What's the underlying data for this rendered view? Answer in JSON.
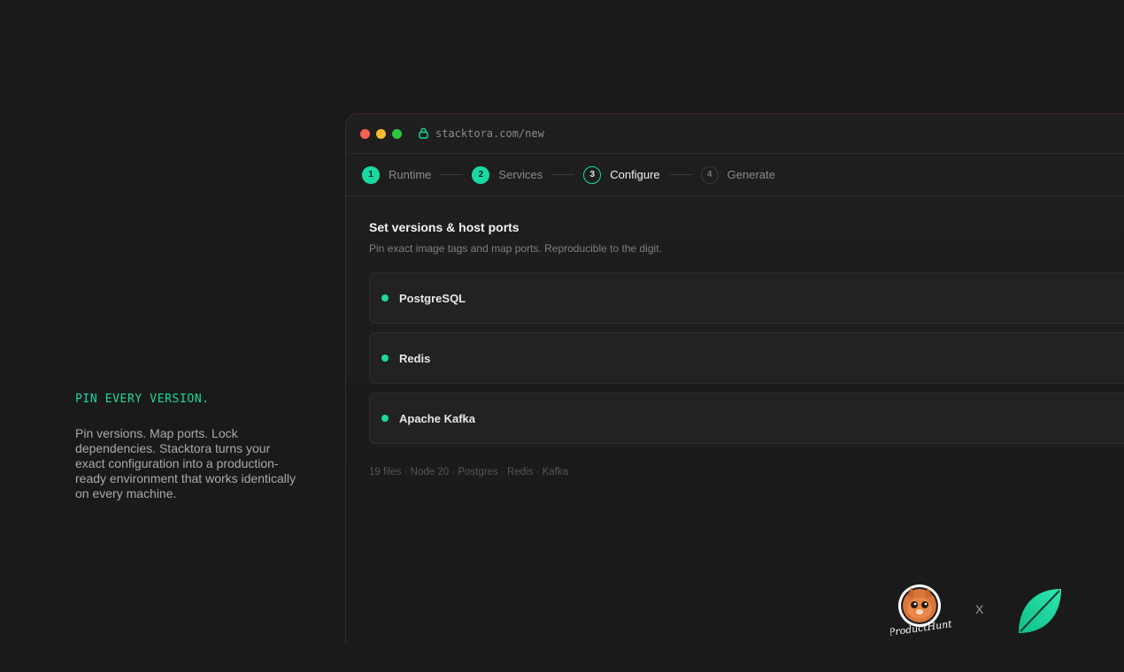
{
  "left": {
    "eyebrow": "PIN EVERY VERSION.",
    "description": "Pin versions. Map ports. Lock dependencies. Stacktora turns your exact configuration into a production-ready environment that works identically on every machine."
  },
  "window": {
    "url": "stacktora.com/new",
    "steps": [
      {
        "number": "1",
        "label": "Runtime",
        "state": "done"
      },
      {
        "number": "2",
        "label": "Services",
        "state": "done"
      },
      {
        "number": "3",
        "label": "Configure",
        "state": "active"
      },
      {
        "number": "4",
        "label": "Generate",
        "state": "todo"
      }
    ],
    "section_title": "Set versions & host ports",
    "section_subtitle": "Pin exact image tags and map ports. Reproducible to the digit.",
    "services": [
      {
        "name": "PostgreSQL"
      },
      {
        "name": "Redis"
      },
      {
        "name": "Apache Kafka"
      }
    ],
    "summary": "19 files · Node 20 · Postgres · Redis · Kafka"
  },
  "footer": {
    "separator": "X",
    "ph_logo_text": "ProductHunt"
  },
  "colors": {
    "accent": "#19d9a0",
    "background": "#1a1a1a",
    "window_border": "#3e2a22"
  },
  "icons": [
    "lock-icon",
    "product-hunt-logo",
    "leaf-logo"
  ]
}
